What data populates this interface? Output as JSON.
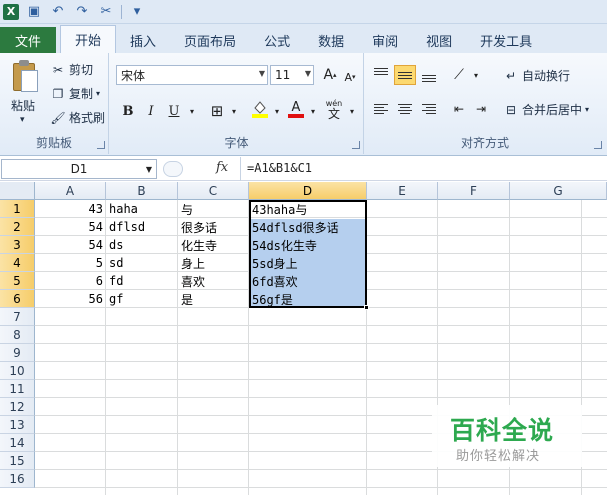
{
  "qat": {
    "icons": [
      "excel-icon",
      "save-icon",
      "undo-icon",
      "redo-icon",
      "customize-icon"
    ]
  },
  "tabs": [
    {
      "label": "文件"
    },
    {
      "label": "开始"
    },
    {
      "label": "插入"
    },
    {
      "label": "页面布局"
    },
    {
      "label": "公式"
    },
    {
      "label": "数据"
    },
    {
      "label": "审阅"
    },
    {
      "label": "视图"
    },
    {
      "label": "开发工具"
    }
  ],
  "ribbon": {
    "clipboard": {
      "paste": "粘贴",
      "cut": "剪切",
      "copy": "复制",
      "format_painter": "格式刷",
      "label": "剪贴板"
    },
    "font": {
      "name": "宋体",
      "size": "11",
      "bold": "B",
      "italic": "I",
      "underline": "U",
      "label": "字体",
      "wen": "wén",
      "wen_char": "文",
      "grow": "A",
      "shrink": "A",
      "color_letter": "A"
    },
    "alignment": {
      "wrap": "自动换行",
      "merge": "合并后居中",
      "label": "对齐方式"
    }
  },
  "formula_bar": {
    "name_box": "D1",
    "fx": "fx",
    "formula": "=A1&B1&C1"
  },
  "columns": [
    "A",
    "B",
    "C",
    "D",
    "E",
    "F",
    "G"
  ],
  "rows": [
    "1",
    "2",
    "3",
    "4",
    "5",
    "6",
    "7",
    "8",
    "9",
    "10",
    "11",
    "12",
    "13",
    "14",
    "15",
    "16"
  ],
  "cells": [
    {
      "a": "43",
      "b": "haha",
      "c": "与",
      "d": "43haha与"
    },
    {
      "a": "54",
      "b": "dflsd",
      "c": "很多话",
      "d": "54dflsd很多话"
    },
    {
      "a": "54",
      "b": "ds",
      "c": "化生寺",
      "d": "54ds化生寺"
    },
    {
      "a": "5",
      "b": "sd",
      "c": "身上",
      "d": "5sd身上"
    },
    {
      "a": "6",
      "b": "fd",
      "c": "喜欢",
      "d": "6fd喜欢"
    },
    {
      "a": "56",
      "b": "gf",
      "c": "是",
      "d": "56gf是"
    }
  ],
  "watermark": {
    "title": "百科全说",
    "subtitle": "助你轻松解决"
  }
}
